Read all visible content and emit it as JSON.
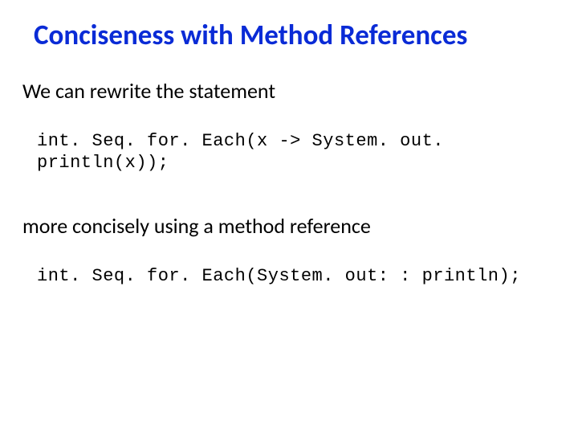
{
  "title": "Conciseness with Method References",
  "line1": "We can rewrite the statement",
  "code1": "int. Seq. for. Each(x -> System. out. println(x));",
  "line2": "more concisely using a method reference",
  "code2": "int. Seq. for. Each(System. out: : println);"
}
